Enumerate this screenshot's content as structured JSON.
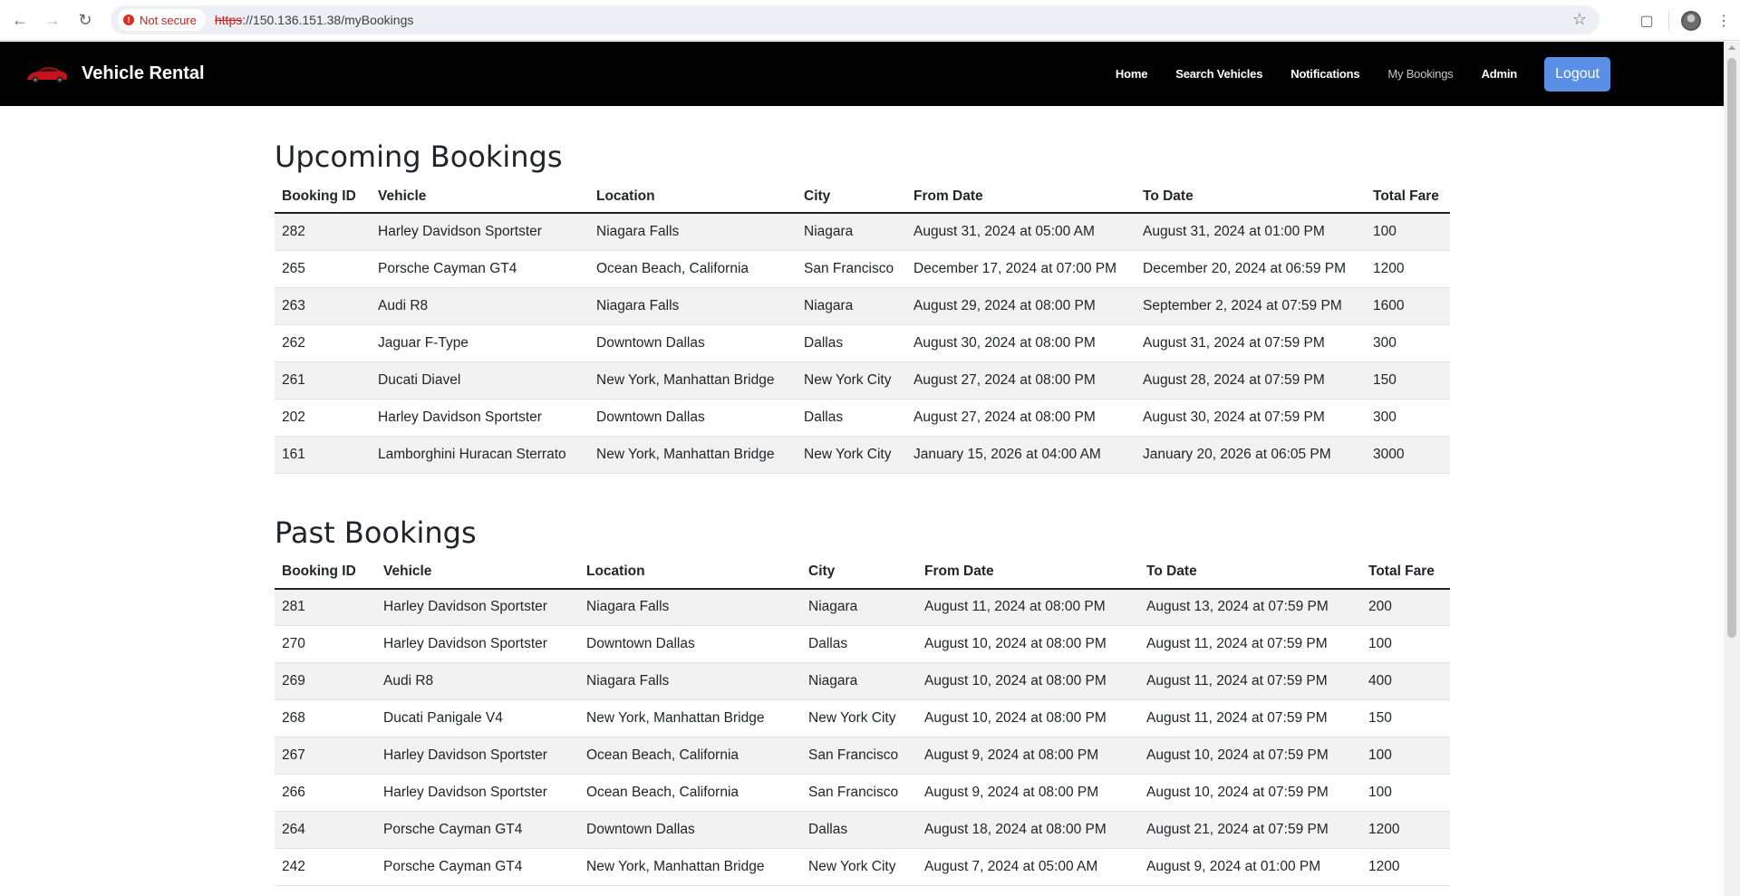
{
  "browser": {
    "security_label": "Not secure",
    "url_scheme": "https",
    "url_rest": "://150.136.151.38/myBookings"
  },
  "navbar": {
    "brand": "Vehicle Rental",
    "links": [
      "Home",
      "Search Vehicles",
      "Notifications",
      "My Bookings",
      "Admin"
    ],
    "logout": "Logout",
    "accent_color": "#5a8fe6"
  },
  "upcoming": {
    "title": "Upcoming Bookings",
    "columns": [
      "Booking ID",
      "Vehicle",
      "Location",
      "City",
      "From Date",
      "To Date",
      "Total Fare"
    ],
    "rows": [
      [
        "282",
        "Harley Davidson Sportster",
        "Niagara Falls",
        "Niagara",
        "August 31, 2024 at 05:00 AM",
        "August 31, 2024 at 01:00 PM",
        "100"
      ],
      [
        "265",
        "Porsche Cayman GT4",
        "Ocean Beach, California",
        "San Francisco",
        "December 17, 2024 at 07:00 PM",
        "December 20, 2024 at 06:59 PM",
        "1200"
      ],
      [
        "263",
        "Audi R8",
        "Niagara Falls",
        "Niagara",
        "August 29, 2024 at 08:00 PM",
        "September 2, 2024 at 07:59 PM",
        "1600"
      ],
      [
        "262",
        "Jaguar F-Type",
        "Downtown Dallas",
        "Dallas",
        "August 30, 2024 at 08:00 PM",
        "August 31, 2024 at 07:59 PM",
        "300"
      ],
      [
        "261",
        "Ducati Diavel",
        "New York, Manhattan Bridge",
        "New York City",
        "August 27, 2024 at 08:00 PM",
        "August 28, 2024 at 07:59 PM",
        "150"
      ],
      [
        "202",
        "Harley Davidson Sportster",
        "Downtown Dallas",
        "Dallas",
        "August 27, 2024 at 08:00 PM",
        "August 30, 2024 at 07:59 PM",
        "300"
      ],
      [
        "161",
        "Lamborghini Huracan Sterrato",
        "New York, Manhattan Bridge",
        "New York City",
        "January 15, 2026 at 04:00 AM",
        "January 20, 2026 at 06:05 PM",
        "3000"
      ]
    ]
  },
  "past": {
    "title": "Past Bookings",
    "columns": [
      "Booking ID",
      "Vehicle",
      "Location",
      "City",
      "From Date",
      "To Date",
      "Total Fare"
    ],
    "rows": [
      [
        "281",
        "Harley Davidson Sportster",
        "Niagara Falls",
        "Niagara",
        "August 11, 2024 at 08:00 PM",
        "August 13, 2024 at 07:59 PM",
        "200"
      ],
      [
        "270",
        "Harley Davidson Sportster",
        "Downtown Dallas",
        "Dallas",
        "August 10, 2024 at 08:00 PM",
        "August 11, 2024 at 07:59 PM",
        "100"
      ],
      [
        "269",
        "Audi R8",
        "Niagara Falls",
        "Niagara",
        "August 10, 2024 at 08:00 PM",
        "August 11, 2024 at 07:59 PM",
        "400"
      ],
      [
        "268",
        "Ducati Panigale V4",
        "New York, Manhattan Bridge",
        "New York City",
        "August 10, 2024 at 08:00 PM",
        "August 11, 2024 at 07:59 PM",
        "150"
      ],
      [
        "267",
        "Harley Davidson Sportster",
        "Ocean Beach, California",
        "San Francisco",
        "August 9, 2024 at 08:00 PM",
        "August 10, 2024 at 07:59 PM",
        "100"
      ],
      [
        "266",
        "Harley Davidson Sportster",
        "Ocean Beach, California",
        "San Francisco",
        "August 9, 2024 at 08:00 PM",
        "August 10, 2024 at 07:59 PM",
        "100"
      ],
      [
        "264",
        "Porsche Cayman GT4",
        "Downtown Dallas",
        "Dallas",
        "August 18, 2024 at 08:00 PM",
        "August 21, 2024 at 07:59 PM",
        "1200"
      ],
      [
        "242",
        "Porsche Cayman GT4",
        "New York, Manhattan Bridge",
        "New York City",
        "August 7, 2024 at 05:00 AM",
        "August 9, 2024 at 01:00 PM",
        "1200"
      ]
    ]
  }
}
